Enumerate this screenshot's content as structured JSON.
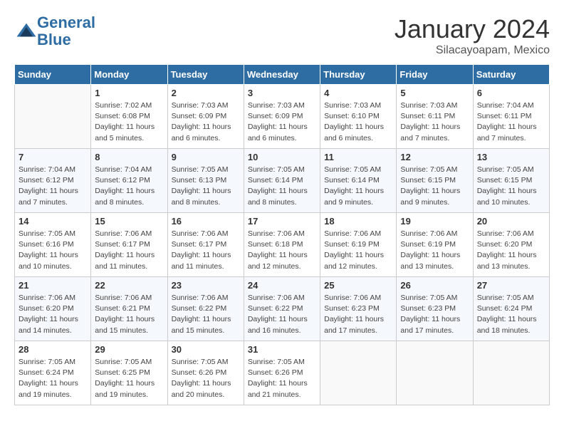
{
  "header": {
    "logo_line1": "General",
    "logo_line2": "Blue",
    "month": "January 2024",
    "location": "Silacayoapam, Mexico"
  },
  "days_of_week": [
    "Sunday",
    "Monday",
    "Tuesday",
    "Wednesday",
    "Thursday",
    "Friday",
    "Saturday"
  ],
  "weeks": [
    [
      {
        "day": "",
        "detail": ""
      },
      {
        "day": "1",
        "detail": "Sunrise: 7:02 AM\nSunset: 6:08 PM\nDaylight: 11 hours\nand 5 minutes."
      },
      {
        "day": "2",
        "detail": "Sunrise: 7:03 AM\nSunset: 6:09 PM\nDaylight: 11 hours\nand 6 minutes."
      },
      {
        "day": "3",
        "detail": "Sunrise: 7:03 AM\nSunset: 6:09 PM\nDaylight: 11 hours\nand 6 minutes."
      },
      {
        "day": "4",
        "detail": "Sunrise: 7:03 AM\nSunset: 6:10 PM\nDaylight: 11 hours\nand 6 minutes."
      },
      {
        "day": "5",
        "detail": "Sunrise: 7:03 AM\nSunset: 6:11 PM\nDaylight: 11 hours\nand 7 minutes."
      },
      {
        "day": "6",
        "detail": "Sunrise: 7:04 AM\nSunset: 6:11 PM\nDaylight: 11 hours\nand 7 minutes."
      }
    ],
    [
      {
        "day": "7",
        "detail": "Sunrise: 7:04 AM\nSunset: 6:12 PM\nDaylight: 11 hours\nand 7 minutes."
      },
      {
        "day": "8",
        "detail": "Sunrise: 7:04 AM\nSunset: 6:12 PM\nDaylight: 11 hours\nand 8 minutes."
      },
      {
        "day": "9",
        "detail": "Sunrise: 7:05 AM\nSunset: 6:13 PM\nDaylight: 11 hours\nand 8 minutes."
      },
      {
        "day": "10",
        "detail": "Sunrise: 7:05 AM\nSunset: 6:14 PM\nDaylight: 11 hours\nand 8 minutes."
      },
      {
        "day": "11",
        "detail": "Sunrise: 7:05 AM\nSunset: 6:14 PM\nDaylight: 11 hours\nand 9 minutes."
      },
      {
        "day": "12",
        "detail": "Sunrise: 7:05 AM\nSunset: 6:15 PM\nDaylight: 11 hours\nand 9 minutes."
      },
      {
        "day": "13",
        "detail": "Sunrise: 7:05 AM\nSunset: 6:15 PM\nDaylight: 11 hours\nand 10 minutes."
      }
    ],
    [
      {
        "day": "14",
        "detail": "Sunrise: 7:05 AM\nSunset: 6:16 PM\nDaylight: 11 hours\nand 10 minutes."
      },
      {
        "day": "15",
        "detail": "Sunrise: 7:06 AM\nSunset: 6:17 PM\nDaylight: 11 hours\nand 11 minutes."
      },
      {
        "day": "16",
        "detail": "Sunrise: 7:06 AM\nSunset: 6:17 PM\nDaylight: 11 hours\nand 11 minutes."
      },
      {
        "day": "17",
        "detail": "Sunrise: 7:06 AM\nSunset: 6:18 PM\nDaylight: 11 hours\nand 12 minutes."
      },
      {
        "day": "18",
        "detail": "Sunrise: 7:06 AM\nSunset: 6:19 PM\nDaylight: 11 hours\nand 12 minutes."
      },
      {
        "day": "19",
        "detail": "Sunrise: 7:06 AM\nSunset: 6:19 PM\nDaylight: 11 hours\nand 13 minutes."
      },
      {
        "day": "20",
        "detail": "Sunrise: 7:06 AM\nSunset: 6:20 PM\nDaylight: 11 hours\nand 13 minutes."
      }
    ],
    [
      {
        "day": "21",
        "detail": "Sunrise: 7:06 AM\nSunset: 6:20 PM\nDaylight: 11 hours\nand 14 minutes."
      },
      {
        "day": "22",
        "detail": "Sunrise: 7:06 AM\nSunset: 6:21 PM\nDaylight: 11 hours\nand 15 minutes."
      },
      {
        "day": "23",
        "detail": "Sunrise: 7:06 AM\nSunset: 6:22 PM\nDaylight: 11 hours\nand 15 minutes."
      },
      {
        "day": "24",
        "detail": "Sunrise: 7:06 AM\nSunset: 6:22 PM\nDaylight: 11 hours\nand 16 minutes."
      },
      {
        "day": "25",
        "detail": "Sunrise: 7:06 AM\nSunset: 6:23 PM\nDaylight: 11 hours\nand 17 minutes."
      },
      {
        "day": "26",
        "detail": "Sunrise: 7:05 AM\nSunset: 6:23 PM\nDaylight: 11 hours\nand 17 minutes."
      },
      {
        "day": "27",
        "detail": "Sunrise: 7:05 AM\nSunset: 6:24 PM\nDaylight: 11 hours\nand 18 minutes."
      }
    ],
    [
      {
        "day": "28",
        "detail": "Sunrise: 7:05 AM\nSunset: 6:24 PM\nDaylight: 11 hours\nand 19 minutes."
      },
      {
        "day": "29",
        "detail": "Sunrise: 7:05 AM\nSunset: 6:25 PM\nDaylight: 11 hours\nand 19 minutes."
      },
      {
        "day": "30",
        "detail": "Sunrise: 7:05 AM\nSunset: 6:26 PM\nDaylight: 11 hours\nand 20 minutes."
      },
      {
        "day": "31",
        "detail": "Sunrise: 7:05 AM\nSunset: 6:26 PM\nDaylight: 11 hours\nand 21 minutes."
      },
      {
        "day": "",
        "detail": ""
      },
      {
        "day": "",
        "detail": ""
      },
      {
        "day": "",
        "detail": ""
      }
    ]
  ]
}
